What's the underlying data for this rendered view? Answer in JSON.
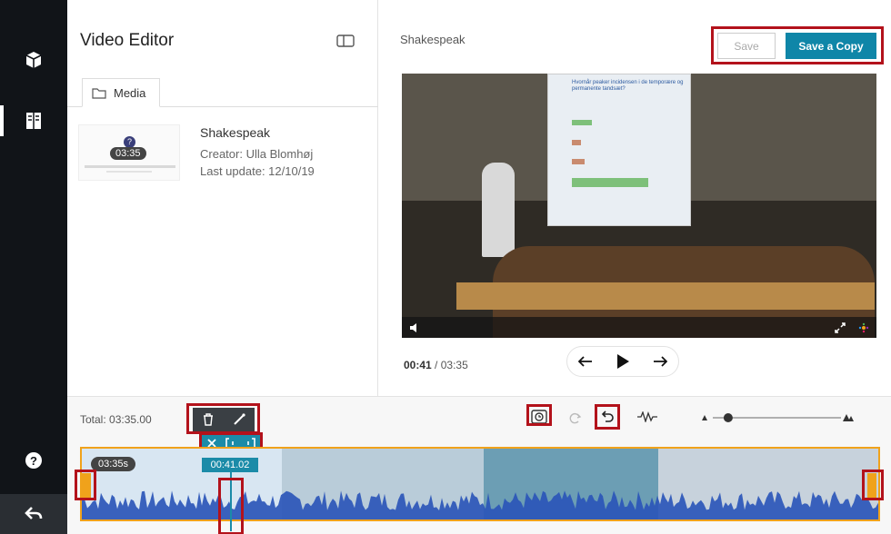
{
  "sidebar": {
    "icons": [
      "cube-icon",
      "book-icon"
    ],
    "help_icon": "help-icon",
    "back_icon": "back-icon"
  },
  "editor": {
    "title": "Video Editor",
    "media_tab": "Media"
  },
  "media_item": {
    "duration": "03:35",
    "name": "Shakespeak",
    "creator": "Creator: Ulla Blomhøj",
    "last_update": "Last update: 12/10/19"
  },
  "player": {
    "title": "Shakespeak",
    "save_label": "Save",
    "save_copy_label": "Save a Copy",
    "current_time": "00:41",
    "separator": "/",
    "total_time": "03:35",
    "slide_title": "Hvornår peaker incidensen i de temporære og permanente tandsæt?"
  },
  "timeline": {
    "total_label": "Total: 03:35.00",
    "clip_duration": "03:35s",
    "playhead_time": "00:41.02",
    "zoom_level": 0.12,
    "colors": {
      "accent": "#1b8ba8",
      "highlight": "#b3121b",
      "clip_border": "#f0a21b",
      "wave": "#2b56b8"
    }
  }
}
